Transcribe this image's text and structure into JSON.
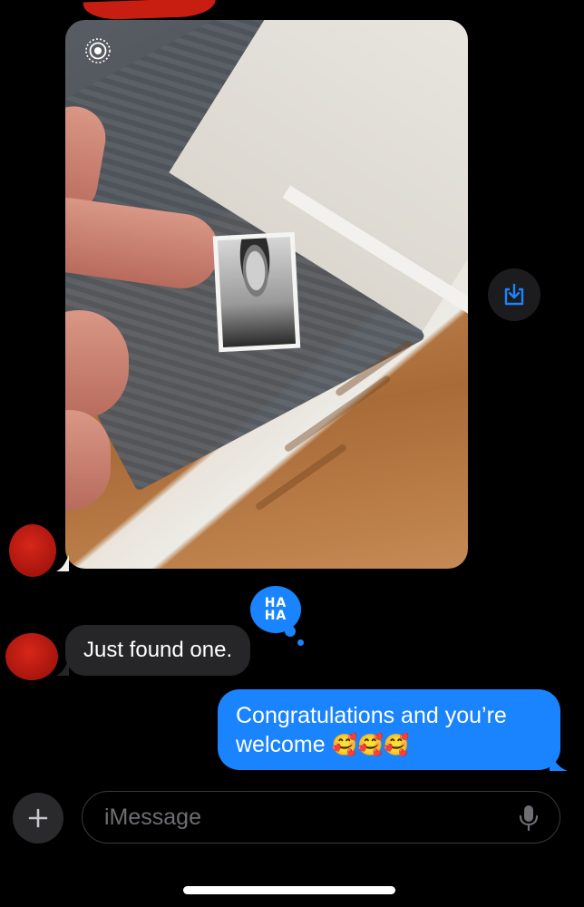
{
  "conversation": {
    "photo_message": {
      "live_photo_icon": "live-photo-icon",
      "save_icon": "save-to-photos-icon"
    },
    "received_message": {
      "text": "Just found one.",
      "tapback": {
        "line1": "HA",
        "line2": "HA"
      }
    },
    "sent_message": {
      "text_line1": "Congratulations and you’re",
      "text_line2": "welcome",
      "emoji": "🥰🥰🥰"
    }
  },
  "composer": {
    "plus_icon": "plus-icon",
    "placeholder": "iMessage",
    "mic_icon": "microphone-icon"
  },
  "colors": {
    "background": "#000000",
    "sent_bubble": "#1a84ff",
    "received_bubble": "#262628",
    "accent": "#1a84ff"
  }
}
